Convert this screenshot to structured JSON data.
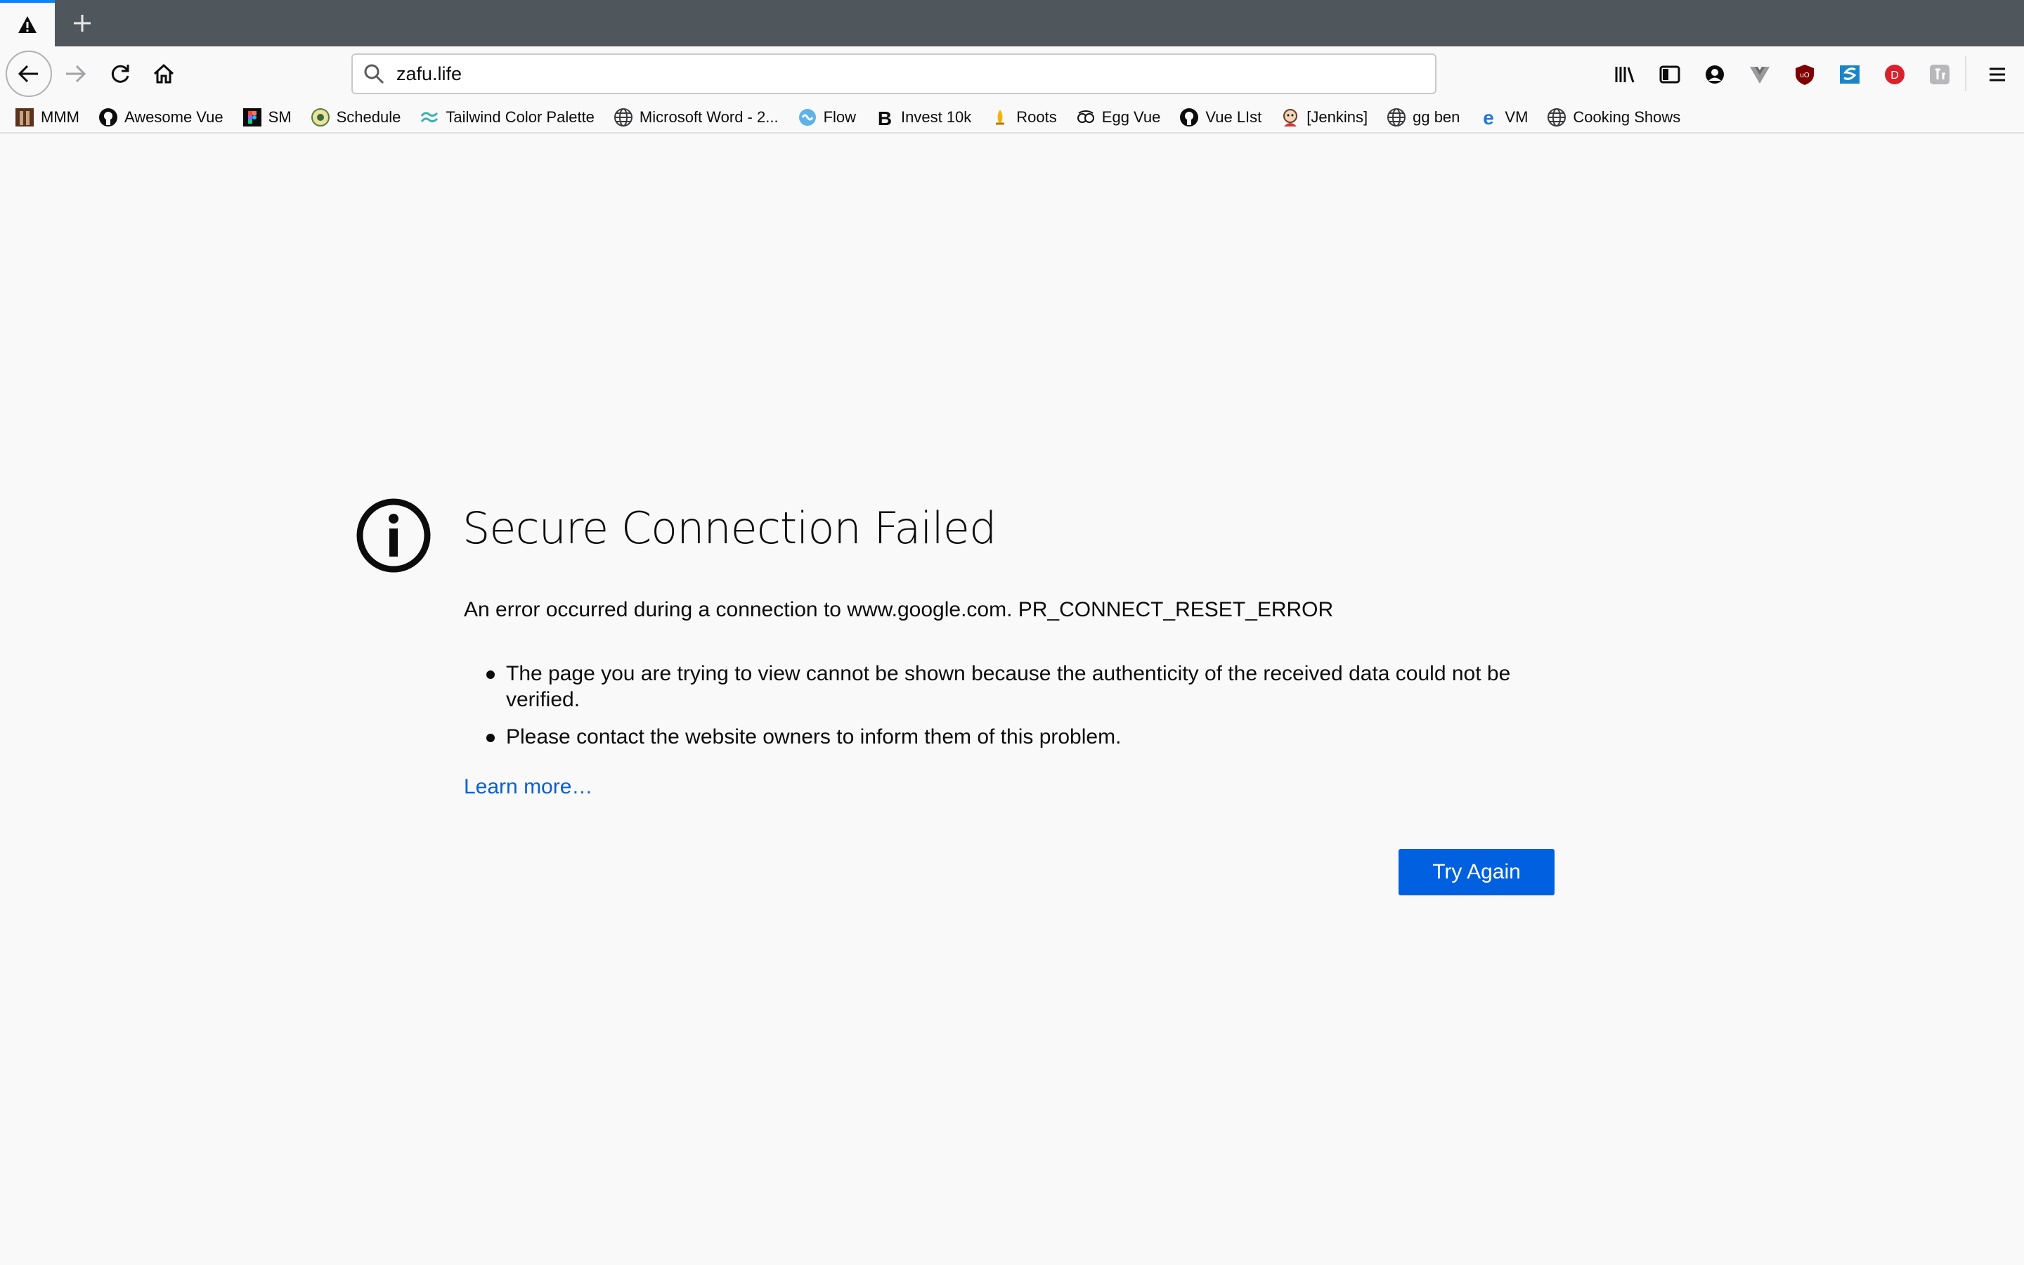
{
  "tab": {
    "icon": "warning-icon"
  },
  "url": "zafu.life",
  "bookmarks": [
    {
      "label": "MMM",
      "icon": "mmm-favicon"
    },
    {
      "label": "Awesome Vue",
      "icon": "github-icon"
    },
    {
      "label": "SM",
      "icon": "figma-icon"
    },
    {
      "label": "Schedule",
      "icon": "schedule-favicon"
    },
    {
      "label": "Tailwind Color Palette",
      "icon": "tailwind-icon"
    },
    {
      "label": "Microsoft Word - 2...",
      "icon": "globe-icon"
    },
    {
      "label": "Flow",
      "icon": "flow-icon"
    },
    {
      "label": "Invest 10k",
      "icon": "b-icon"
    },
    {
      "label": "Roots",
      "icon": "roots-icon"
    },
    {
      "label": "Egg Vue",
      "icon": "egg-icon"
    },
    {
      "label": "Vue LIst",
      "icon": "github-icon"
    },
    {
      "label": "[Jenkins]",
      "icon": "jenkins-icon"
    },
    {
      "label": "gg ben",
      "icon": "globe-icon"
    },
    {
      "label": "VM",
      "icon": "edge-icon"
    },
    {
      "label": "Cooking Shows",
      "icon": "globe-icon"
    }
  ],
  "error": {
    "title": "Secure Connection Failed",
    "description": "An error occurred during a connection to www.google.com. PR_CONNECT_RESET_ERROR",
    "bullets": [
      "The page you are trying to view cannot be shown because the authenticity of the received data could not be verified.",
      "Please contact the website owners to inform them of this problem."
    ],
    "learn_more": "Learn more…",
    "try_again": "Try Again"
  },
  "colors": {
    "accent": "#0060df",
    "link": "#0a60d0",
    "tabstrip": "#50575c",
    "ublock": "#800000",
    "dashlane": "#d9212c"
  }
}
